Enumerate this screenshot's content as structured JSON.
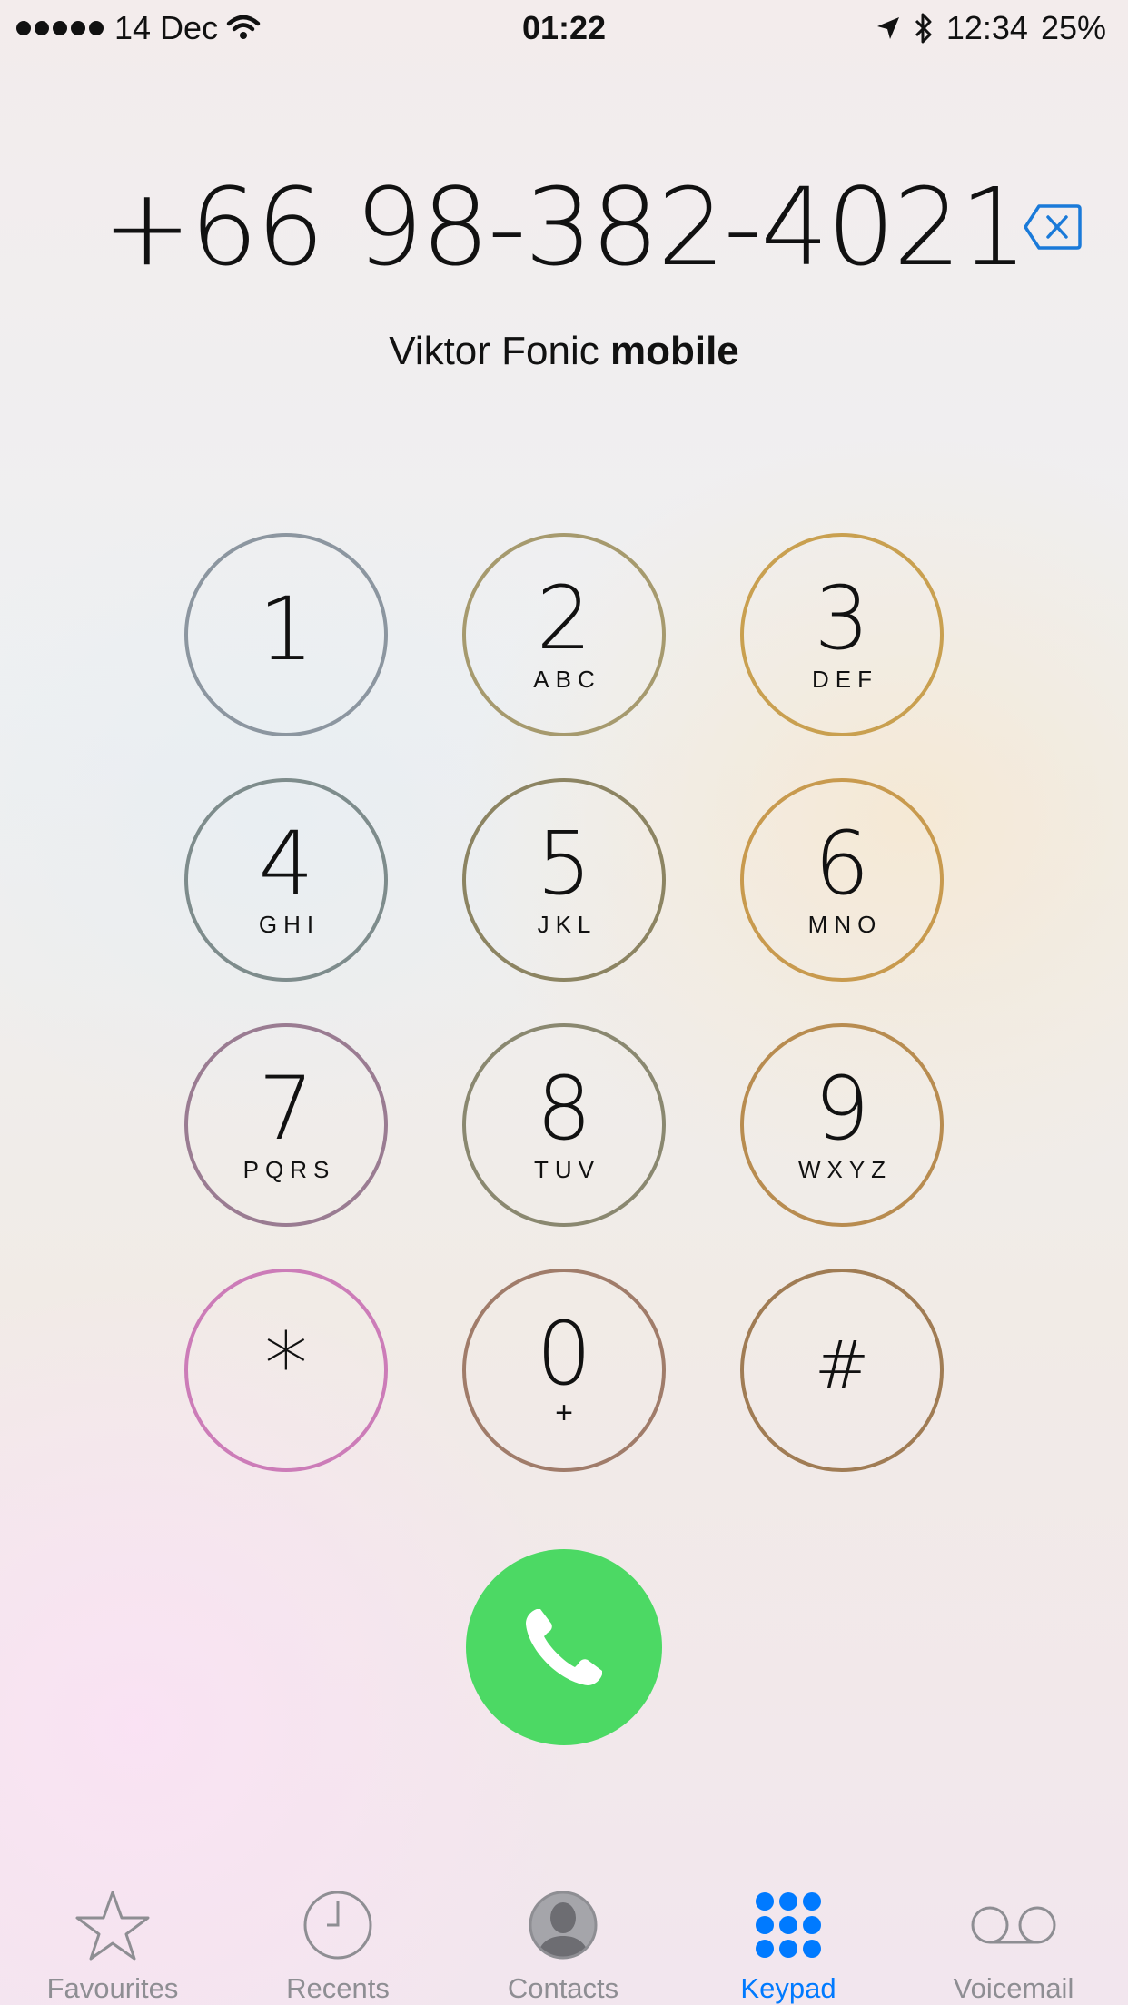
{
  "status_bar": {
    "date": "14 Dec",
    "center_time": "01:22",
    "right_time": "12:34",
    "battery": "25%"
  },
  "dialer": {
    "number": "+66 98-382-4021",
    "contact_name": "Viktor Fonic",
    "contact_label": "mobile"
  },
  "keys": [
    {
      "digit": "1",
      "letters": "",
      "color": "#8c96a0"
    },
    {
      "digit": "2",
      "letters": "ABC",
      "color": "#a69a6e"
    },
    {
      "digit": "3",
      "letters": "DEF",
      "color": "#c9a050"
    },
    {
      "digit": "4",
      "letters": "GHI",
      "color": "#7e8c8c"
    },
    {
      "digit": "5",
      "letters": "JKL",
      "color": "#8c8462"
    },
    {
      "digit": "6",
      "letters": "MNO",
      "color": "#c89a4e"
    },
    {
      "digit": "7",
      "letters": "PQRS",
      "color": "#9a7c92"
    },
    {
      "digit": "8",
      "letters": "TUV",
      "color": "#8a8870"
    },
    {
      "digit": "9",
      "letters": "WXYZ",
      "color": "#b88c50"
    },
    {
      "digit": "*",
      "letters": "",
      "color": "#cc7cb8"
    },
    {
      "digit": "0",
      "letters": "+",
      "color": "#a07c6a"
    },
    {
      "digit": "#",
      "letters": "",
      "color": "#a07c54"
    }
  ],
  "call_button": {
    "color": "#4cd964",
    "icon": "phone-icon"
  },
  "tabs": [
    {
      "label": "Favourites",
      "icon": "star-icon",
      "active": false
    },
    {
      "label": "Recents",
      "icon": "clock-icon",
      "active": false
    },
    {
      "label": "Contacts",
      "icon": "contact-icon",
      "active": false
    },
    {
      "label": "Keypad",
      "icon": "keypad-icon",
      "active": true
    },
    {
      "label": "Voicemail",
      "icon": "voicemail-icon",
      "active": false
    }
  ],
  "accent_color": "#007aff"
}
